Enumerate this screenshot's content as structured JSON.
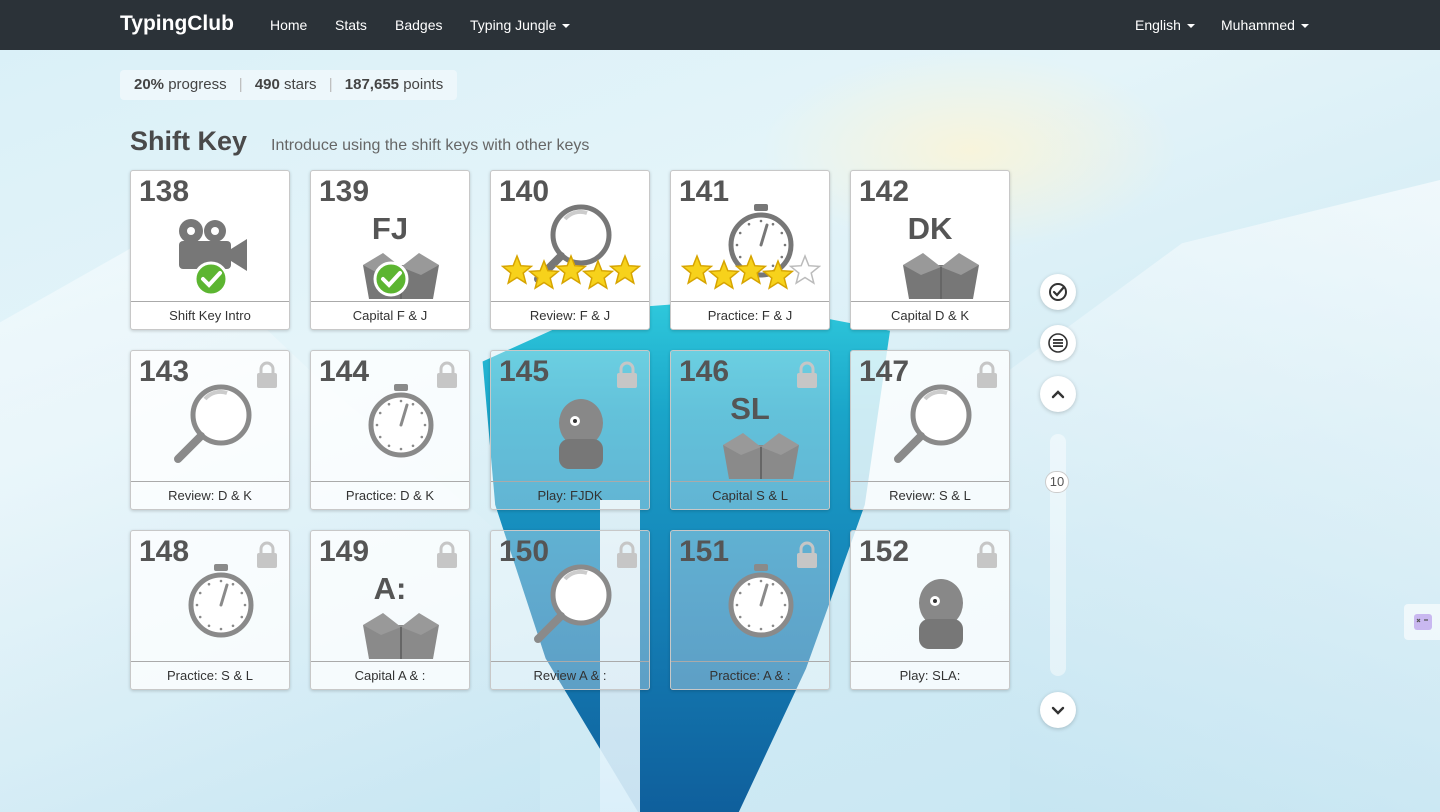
{
  "navbar": {
    "brand": "TypingClub",
    "links": [
      "Home",
      "Stats",
      "Badges",
      "Typing Jungle"
    ],
    "language": "English",
    "user": "Muhammed"
  },
  "summary": {
    "progress_value": "20%",
    "progress_label": "progress",
    "stars_value": "490",
    "stars_label": "stars",
    "points_value": "187,655",
    "points_label": "points"
  },
  "section": {
    "title": "Shift Key",
    "subtitle": "Introduce using the shift keys with other keys"
  },
  "lessons": [
    {
      "number": "138",
      "label": "Shift Key Intro",
      "icon": "video-camera-icon",
      "status": "completed"
    },
    {
      "number": "139",
      "label": "Capital F & J",
      "icon": "box-icon",
      "keys": "FJ",
      "status": "completed"
    },
    {
      "number": "140",
      "label": "Review: F & J",
      "icon": "magnifier-icon",
      "status": "completed",
      "stars": 5
    },
    {
      "number": "141",
      "label": "Practice: F & J",
      "icon": "stopwatch-icon",
      "status": "completed",
      "stars": 4
    },
    {
      "number": "142",
      "label": "Capital D & K",
      "icon": "box-icon",
      "keys": "DK",
      "status": "available"
    },
    {
      "number": "143",
      "label": "Review: D & K",
      "icon": "magnifier-icon",
      "status": "locked"
    },
    {
      "number": "144",
      "label": "Practice: D & K",
      "icon": "stopwatch-icon",
      "status": "locked"
    },
    {
      "number": "145",
      "label": "Play: FJDK",
      "icon": "game-icon",
      "status": "locked"
    },
    {
      "number": "146",
      "label": "Capital S & L",
      "icon": "box-icon",
      "keys": "SL",
      "status": "locked"
    },
    {
      "number": "147",
      "label": "Review: S & L",
      "icon": "magnifier-icon",
      "status": "locked"
    },
    {
      "number": "148",
      "label": "Practice: S & L",
      "icon": "stopwatch-icon",
      "status": "locked"
    },
    {
      "number": "149",
      "label": "Capital A & :",
      "icon": "box-icon",
      "keys": "A:",
      "status": "locked"
    },
    {
      "number": "150",
      "label": "Review A & :",
      "icon": "magnifier-icon",
      "status": "locked"
    },
    {
      "number": "151",
      "label": "Practice: A & :",
      "icon": "stopwatch-icon",
      "status": "locked"
    },
    {
      "number": "152",
      "label": "Play: SLA:",
      "icon": "game-icon",
      "status": "locked"
    }
  ],
  "controls": {
    "current_level": "10",
    "buttons": [
      "check-circle-icon",
      "menu-icon",
      "chevron-up-icon",
      "chevron-down-icon"
    ]
  },
  "colors": {
    "navbar": "#2b3238",
    "check_green": "#5cb531",
    "star_yellow": "#f7d21b",
    "tile_text": "#555555"
  }
}
